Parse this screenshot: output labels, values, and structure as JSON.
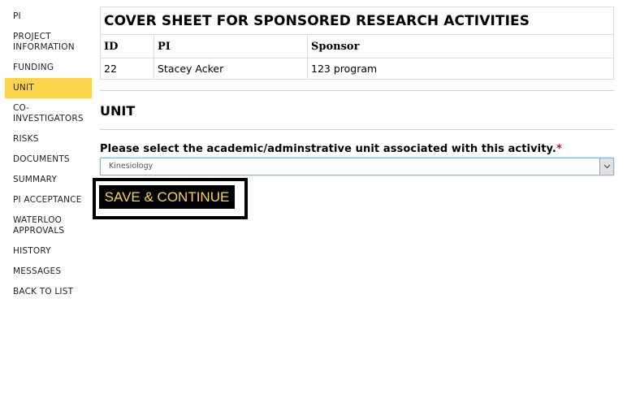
{
  "sidebar": {
    "items": [
      {
        "label": "PI",
        "active": false
      },
      {
        "label": "PROJECT INFORMATION",
        "active": false
      },
      {
        "label": "FUNDING",
        "active": false
      },
      {
        "label": "UNIT",
        "active": true
      },
      {
        "label": "CO-INVESTIGATORS",
        "active": false
      },
      {
        "label": "RISKS",
        "active": false
      },
      {
        "label": "DOCUMENTS",
        "active": false
      },
      {
        "label": "SUMMARY",
        "active": false
      },
      {
        "label": "PI ACCEPTANCE",
        "active": false
      },
      {
        "label": "WATERLOO APPROVALS",
        "active": false
      },
      {
        "label": "HISTORY",
        "active": false
      },
      {
        "label": "MESSAGES",
        "active": false
      },
      {
        "label": "BACK TO LIST",
        "active": false
      }
    ]
  },
  "cover_sheet": {
    "title": "COVER SHEET FOR SPONSORED RESEARCH ACTIVITIES",
    "columns": [
      "ID",
      "PI",
      "Sponsor"
    ],
    "rows": [
      [
        "22",
        "Stacey Acker",
        "123 program"
      ]
    ]
  },
  "section": {
    "title": "UNIT",
    "field_label": "Please select the academic/adminstrative unit associated with this activity.",
    "required_marker": "*",
    "unit_select": {
      "selected": "Kinesiology",
      "icon": "chevron-down-icon"
    },
    "save_label": "SAVE & CONTINUE"
  },
  "colors": {
    "accent": "#fed34c",
    "button_bg": "#000000",
    "required": "#c8102e"
  }
}
